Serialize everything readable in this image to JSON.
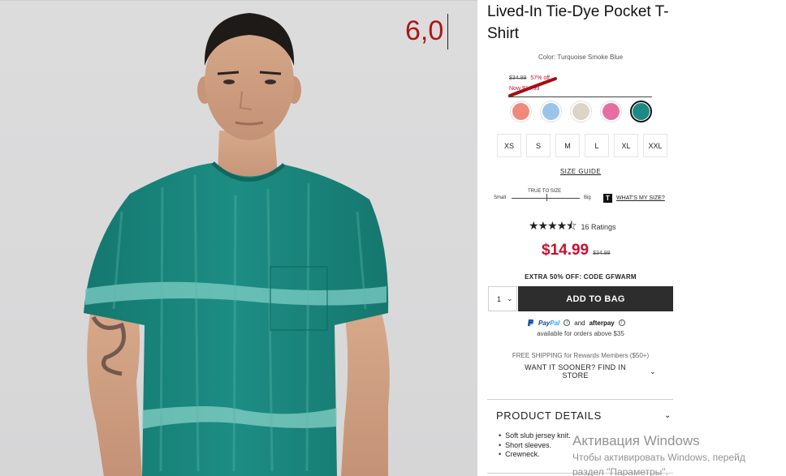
{
  "overlay": {
    "text": "6,0"
  },
  "product": {
    "title": "Lived-In Tie-Dye Pocket T-Shirt",
    "color_label": "Color: Turquoise Smoke Blue",
    "crossed_price": "$34.99",
    "discount": "57% off",
    "now_price": "Now $14.99",
    "swatches": [
      {
        "name": "coral",
        "color": "#f0897c"
      },
      {
        "name": "light-blue",
        "color": "#9cc4ea"
      },
      {
        "name": "oatmeal",
        "color": "#ddd3c6"
      },
      {
        "name": "pink",
        "color": "#e46fa0"
      },
      {
        "name": "turquoise",
        "color": "#1c8a83",
        "selected": true
      }
    ],
    "sizes": [
      "XS",
      "S",
      "M",
      "L",
      "XL",
      "XXL"
    ],
    "size_guide": "SIZE GUIDE",
    "fit": {
      "true_label": "TRUE TO SIZE",
      "small": "Small",
      "big": "Big",
      "t_icon": "T",
      "whats_size": "WHAT'S MY SIZE?"
    },
    "rating": {
      "stars": "★★★★⯪",
      "count": "16 Ratings",
      "value": 4.5
    },
    "price": "$14.99",
    "price_old": "$34.99",
    "promo": "EXTRA 50% OFF: CODE GFWARM",
    "qty": "1",
    "add_to_bag": "ADD TO BAG",
    "paypal": {
      "pay": "Pay",
      "pal": "Pal",
      "and": "and",
      "afterpay": "afterpay",
      "avail": "available for orders above $35"
    },
    "free_shipping": "FREE SHIPPING for Rewards Members ($50+)",
    "want_it": "WANT IT SOONER? FIND IN STORE",
    "details_title": "PRODUCT DETAILS",
    "details": [
      "Soft slub jersey knit.",
      "Short sleeves.",
      "Crewneck."
    ]
  },
  "watermark": {
    "title": "Активация Windows",
    "line2": "Чтобы активировать Windows, перейд",
    "line3": "раздел \"Параметры\"."
  },
  "colors": {
    "sale_red": "#c8102e",
    "bag_button": "#2d2d2d",
    "shirt": "#17877d"
  }
}
